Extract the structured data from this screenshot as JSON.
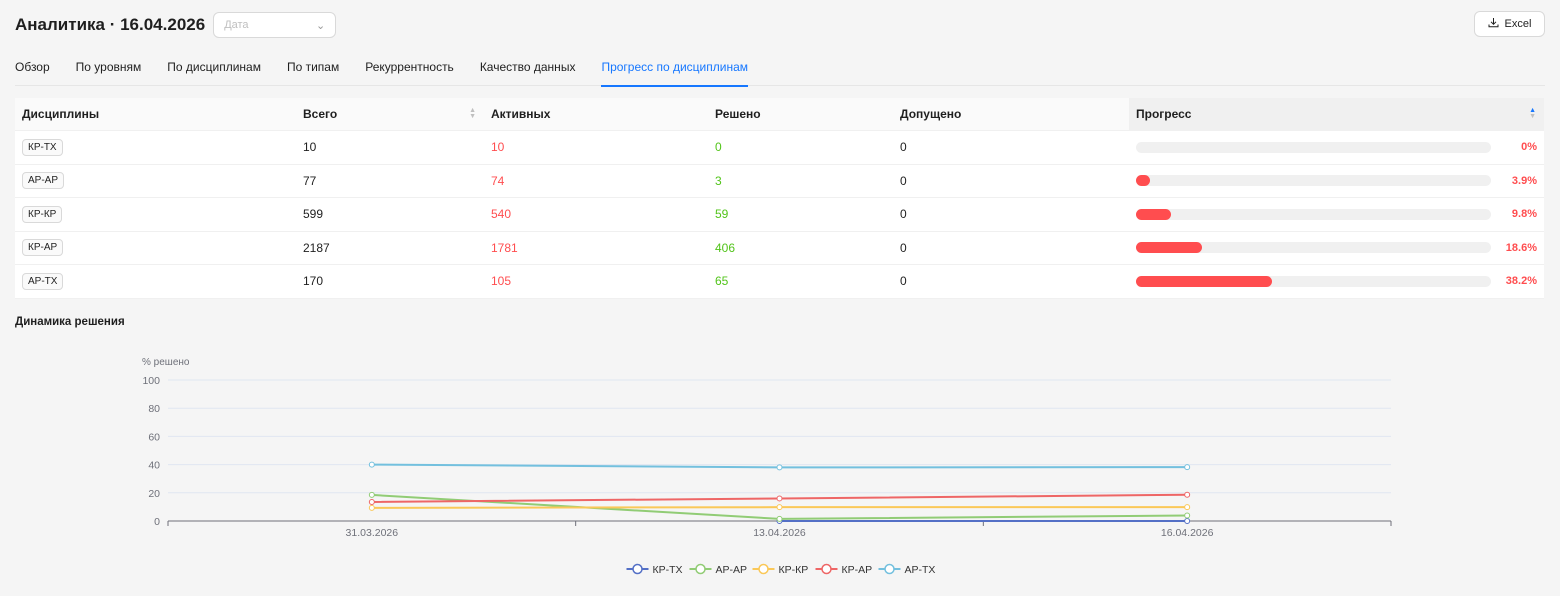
{
  "header": {
    "title": "Аналитика · 16.04.2026",
    "date_placeholder": "Дата",
    "excel_label": "Excel"
  },
  "tabs": [
    {
      "label": "Обзор",
      "active": false
    },
    {
      "label": "По уровням",
      "active": false
    },
    {
      "label": "По дисциплинам",
      "active": false
    },
    {
      "label": "По типам",
      "active": false
    },
    {
      "label": "Рекуррентность",
      "active": false
    },
    {
      "label": "Качество данных",
      "active": false
    },
    {
      "label": "Прогресс по дисциплинам",
      "active": true
    }
  ],
  "table": {
    "headers": [
      "Дисциплины",
      "Всего",
      "Активных",
      "Решено",
      "Допущено",
      "Прогресс"
    ],
    "rows": [
      {
        "discipline": "КР-ТХ",
        "total": "10",
        "active": "10",
        "solved": "0",
        "admitted": "0",
        "progress_label": "0%",
        "progress": 0
      },
      {
        "discipline": "АР-АР",
        "total": "77",
        "active": "74",
        "solved": "3",
        "admitted": "0",
        "progress_label": "3.9%",
        "progress": 3.9
      },
      {
        "discipline": "КР-КР",
        "total": "599",
        "active": "540",
        "solved": "59",
        "admitted": "0",
        "progress_label": "9.8%",
        "progress": 9.8
      },
      {
        "discipline": "КР-АР",
        "total": "2187",
        "active": "1781",
        "solved": "406",
        "admitted": "0",
        "progress_label": "18.6%",
        "progress": 18.6
      },
      {
        "discipline": "АР-ТХ",
        "total": "170",
        "active": "105",
        "solved": "65",
        "admitted": "0",
        "progress_label": "38.2%",
        "progress": 38.2
      }
    ]
  },
  "section": {
    "dynamics_title": "Динамика решения"
  },
  "chart_data": {
    "type": "line",
    "ylabel": "% решено",
    "ylim": [
      0,
      100
    ],
    "yticks": [
      0,
      20,
      40,
      60,
      80,
      100
    ],
    "categories": [
      "31.03.2026",
      "13.04.2026",
      "16.04.2026"
    ],
    "legend_position": "bottom",
    "series": [
      {
        "name": "КР-ТХ",
        "color": "#5470c6",
        "values": [
          null,
          0,
          0
        ]
      },
      {
        "name": "АР-АР",
        "color": "#91cc75",
        "values": [
          18.5,
          1.5,
          3.9
        ]
      },
      {
        "name": "КР-КР",
        "color": "#fac858",
        "values": [
          9.3,
          9.8,
          9.8
        ]
      },
      {
        "name": "КР-АР",
        "color": "#ee6666",
        "values": [
          13.5,
          16.0,
          18.6
        ]
      },
      {
        "name": "АР-ТХ",
        "color": "#73c0de",
        "values": [
          40.0,
          38.0,
          38.2
        ]
      }
    ]
  }
}
